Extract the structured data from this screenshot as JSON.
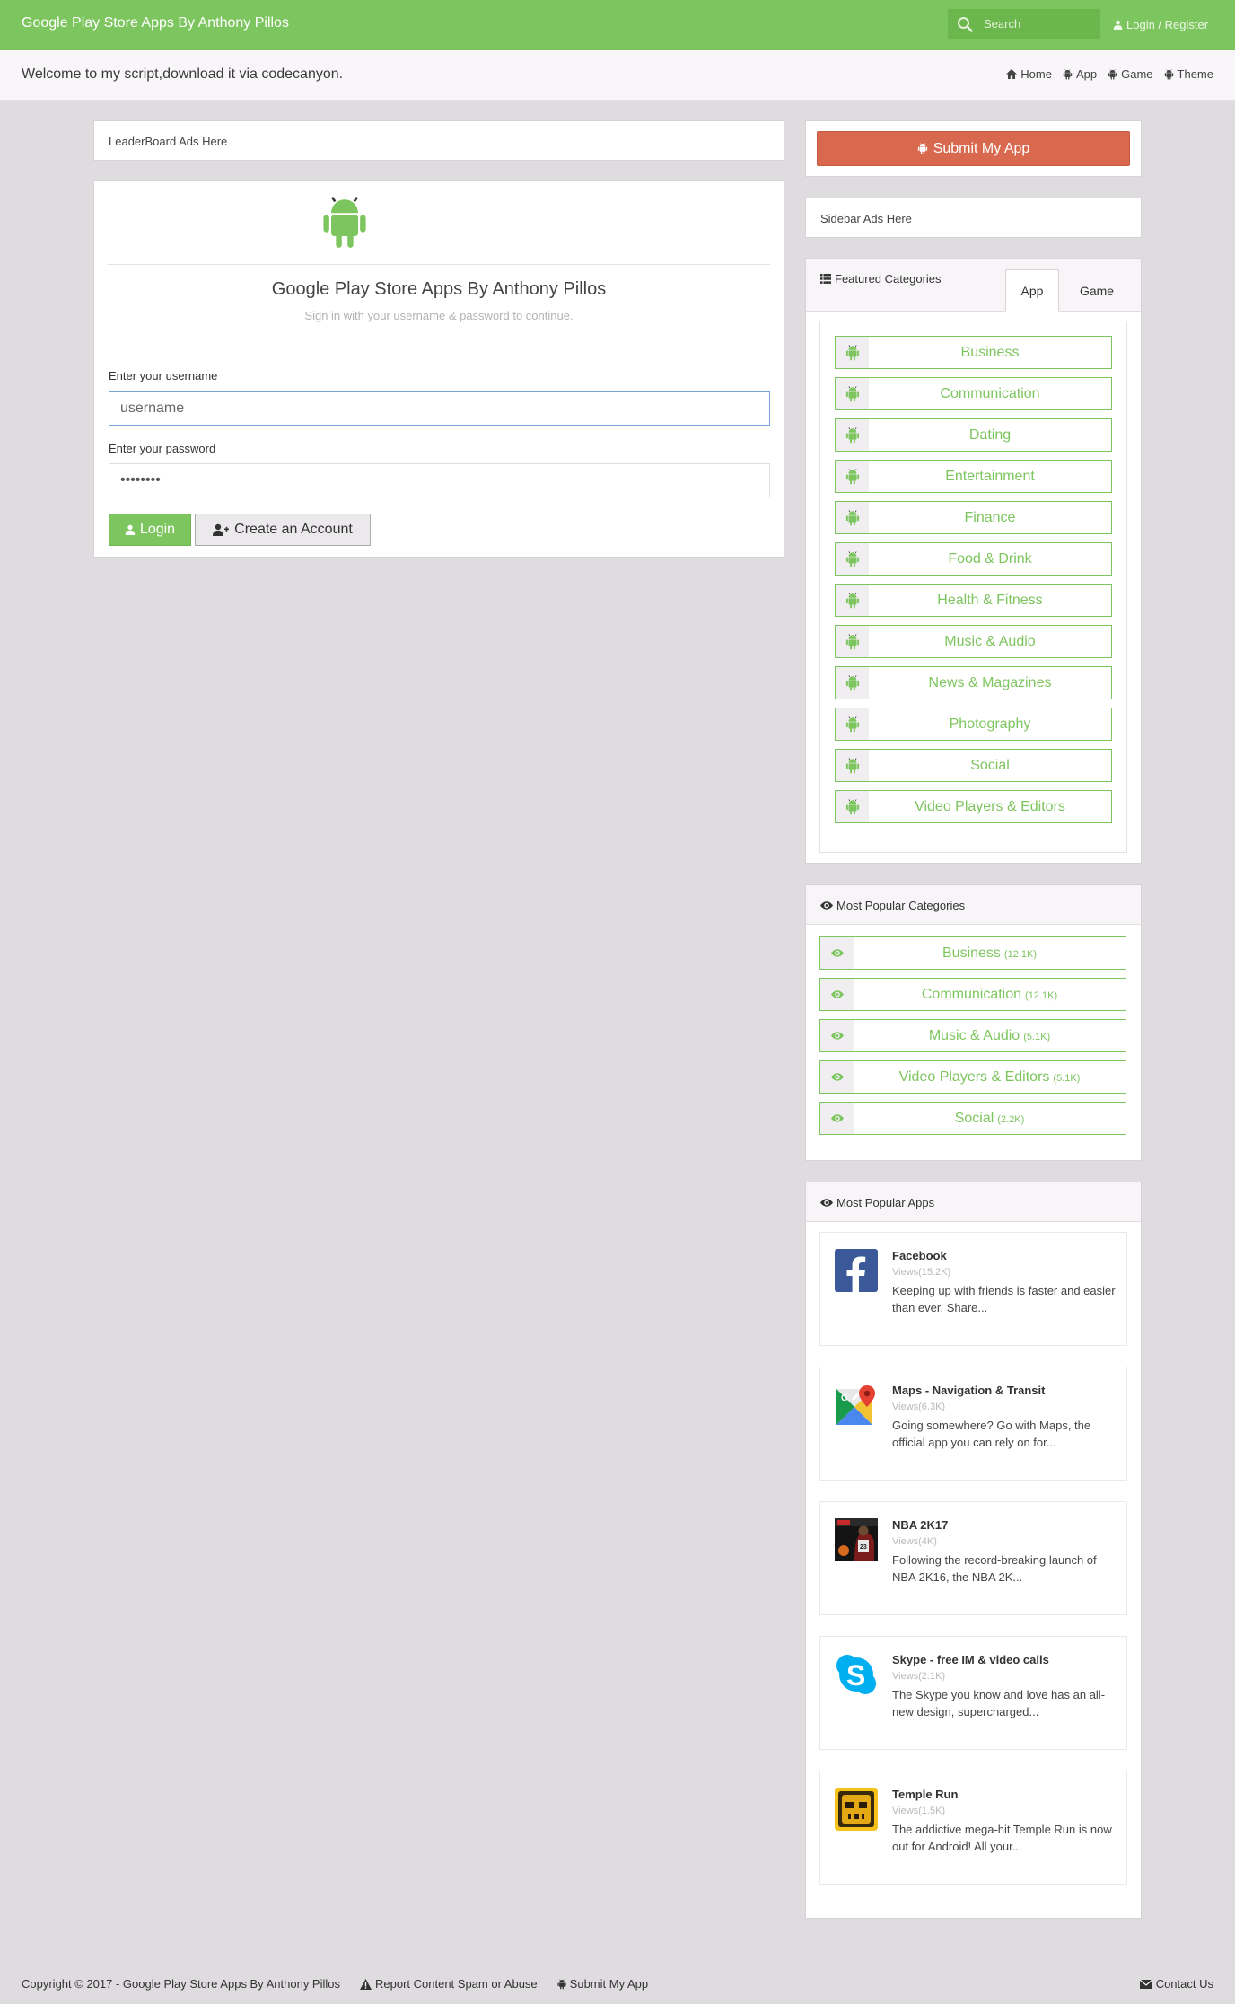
{
  "navbar": {
    "brand": "Google Play Store Apps By Anthony Pillos",
    "search_placeholder": "Search",
    "login_register": "Login / Register"
  },
  "subbar": {
    "welcome": "Welcome to my script,download it via codecanyon.",
    "nav": [
      {
        "label": "Home",
        "icon": "home-icon"
      },
      {
        "label": "App",
        "icon": "android-icon"
      },
      {
        "label": "Game",
        "icon": "android-icon"
      },
      {
        "label": "Theme",
        "icon": "android-icon"
      }
    ]
  },
  "leaderboard_ads": "LeaderBoard Ads Here",
  "login": {
    "title": "Google Play Store Apps By Anthony Pillos",
    "subtitle": "Sign in with your username & password to continue.",
    "username_label": "Enter your username",
    "username_placeholder": "username",
    "password_label": "Enter your password",
    "password_value": "password",
    "login_button": "Login",
    "create_button": "Create an Account"
  },
  "sidebar": {
    "submit_button": "Submit My App",
    "sidebar_ads": "Sidebar Ads Here",
    "featured": {
      "heading": "Featured Categories",
      "tabs": [
        "App",
        "Game"
      ],
      "active_tab": "App",
      "categories": [
        "Business",
        "Communication",
        "Dating",
        "Entertainment",
        "Finance",
        "Food & Drink",
        "Health & Fitness",
        "Music & Audio",
        "News & Magazines",
        "Photography",
        "Social",
        "Video Players & Editors"
      ]
    },
    "popular_categories": {
      "heading": "Most Popular Categories",
      "items": [
        {
          "label": "Business",
          "count": "(12.1K)"
        },
        {
          "label": "Communication",
          "count": "(12.1K)"
        },
        {
          "label": "Music & Audio",
          "count": "(5.1K)"
        },
        {
          "label": "Video Players & Editors",
          "count": "(5.1K)"
        },
        {
          "label": "Social",
          "count": "(2.2K)"
        }
      ]
    },
    "popular_apps": {
      "heading": "Most Popular Apps",
      "items": [
        {
          "name": "Facebook",
          "views": "Views(15.2K)",
          "desc": "Keeping up with friends is faster and easier than ever. Share...",
          "icon": "facebook-icon"
        },
        {
          "name": "Maps - Navigation & Transit",
          "views": "Views(6.3K)",
          "desc": "Going somewhere? Go with Maps, the official app you can rely on for...",
          "icon": "maps-icon"
        },
        {
          "name": "NBA 2K17",
          "views": "Views(4K)",
          "desc": "Following the record-breaking launch of NBA 2K16, the NBA 2K...",
          "icon": "nba2k17-icon"
        },
        {
          "name": "Skype - free IM & video calls",
          "views": "Views(2.1K)",
          "desc": "The Skype you know and love has an all-new design, supercharged...",
          "icon": "skype-icon"
        },
        {
          "name": "Temple Run",
          "views": "Views(1.5K)",
          "desc": "The addictive mega-hit Temple Run is now out for Android! All your...",
          "icon": "temple-run-icon"
        }
      ]
    }
  },
  "footer": {
    "copyright": "Copyright © 2017 - Google Play Store Apps By Anthony Pillos",
    "report": "Report Content Spam or Abuse",
    "submit": "Submit My App",
    "contact": "Contact Us"
  },
  "colors": {
    "brand_green": "#7dc55e",
    "submit_red": "#d8694f",
    "page_bg": "#dfdcdf"
  }
}
